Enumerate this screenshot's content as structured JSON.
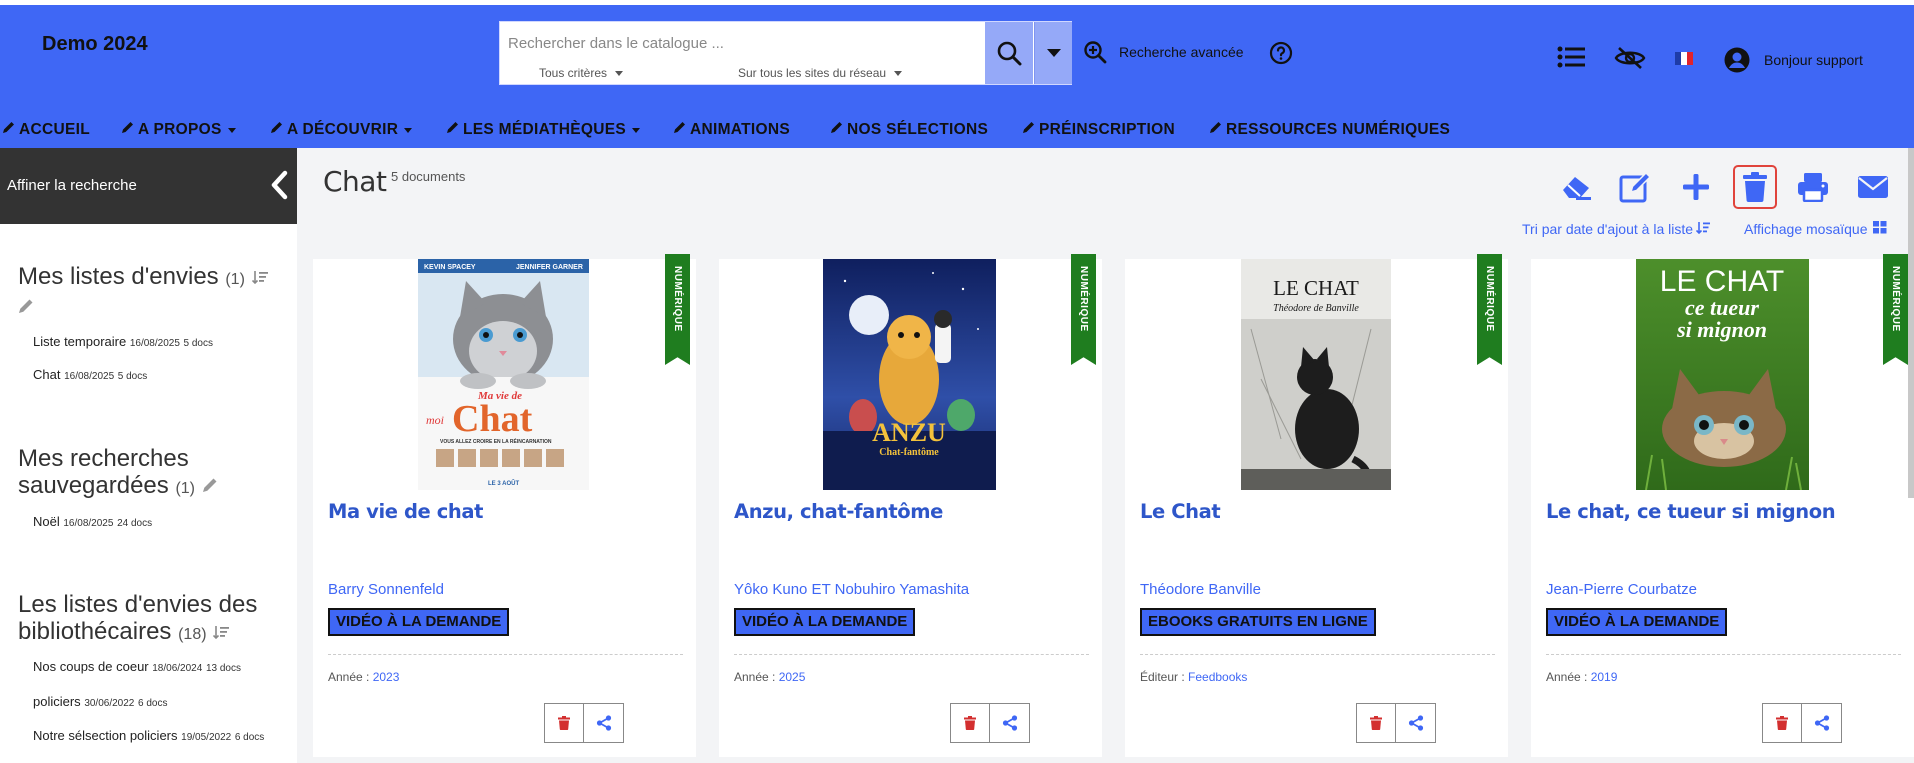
{
  "header": {
    "brand": "Demo 2024",
    "search_placeholder": "Rechercher dans le catalogue ...",
    "criteria_filter": "Tous critères",
    "sites_filter": "Sur tous les sites du réseau",
    "advanced_search": "Recherche avancée",
    "greeting": "Bonjour support"
  },
  "nav": {
    "items": [
      {
        "label": "ACCUEIL",
        "dropdown": false
      },
      {
        "label": "A PROPOS",
        "dropdown": true
      },
      {
        "label": "A DÉCOUVRIR",
        "dropdown": true
      },
      {
        "label": "LES MÉDIATHÈQUES",
        "dropdown": true
      },
      {
        "label": "ANIMATIONS",
        "dropdown": false
      },
      {
        "label": "NOS SÉLECTIONS",
        "dropdown": false
      },
      {
        "label": "PRÉINSCRIPTION",
        "dropdown": false
      },
      {
        "label": "RESSOURCES NUMÉRIQUES",
        "dropdown": false
      }
    ]
  },
  "sidebar": {
    "refine_label": "Affiner la recherche",
    "wishlists": {
      "title": "Mes listes d'envies",
      "count": "(1)",
      "items": [
        {
          "name": "Liste temporaire",
          "date": "16/08/2025",
          "docs": "5 docs"
        },
        {
          "name": "Chat",
          "date": "16/08/2025",
          "docs": "5 docs"
        }
      ]
    },
    "saved_searches": {
      "title_line1": "Mes recherches",
      "title_line2": "sauvegardées",
      "count": "(1)",
      "items": [
        {
          "name": "Noël",
          "date": "16/08/2025",
          "docs": "24 docs"
        }
      ]
    },
    "librarian_lists": {
      "title_line1": "Les listes d'envies des",
      "title_line2": "bibliothécaires",
      "count": "(18)",
      "items": [
        {
          "name": "Nos coups de coeur",
          "date": "18/06/2024",
          "docs": "13 docs"
        },
        {
          "name": "policiers",
          "date": "30/06/2022",
          "docs": "6 docs"
        },
        {
          "name": "Notre sélsection policiers",
          "date": "19/05/2022",
          "docs": "6 docs"
        }
      ]
    }
  },
  "content": {
    "title": "Chat",
    "count": "5 documents",
    "sort_label": "Tri par date d'ajout à la liste",
    "display_label": "Affichage mosaïque"
  },
  "cards": [
    {
      "ribbon": "NUMÉRIQUE",
      "title": "Ma vie de chat",
      "author1": "Barry Sonnenfeld",
      "author_sep": "",
      "author2": "",
      "badge": "VIDÉO À LA DEMANDE",
      "meta_label": "Année : ",
      "meta_value": "2023",
      "cover": {
        "top1": "KEVIN SPACEY",
        "top2": "JENNIFER GARNER",
        "small": "Ma vie de",
        "big": "Chat",
        "tag": "moi",
        "tagline": "VOUS ALLEZ CROIRE EN LA RÉINCARNATION",
        "date": "LE 3 AOÛT"
      }
    },
    {
      "ribbon": "NUMÉRIQUE",
      "title": "Anzu, chat-fantôme",
      "author1": "Yôko Kuno",
      "author_sep": " ET ",
      "author2": "Nobuhiro Yamashita",
      "badge": "VIDÉO À LA DEMANDE",
      "meta_label": "Année : ",
      "meta_value": "2025",
      "cover": {
        "big": "ANZU",
        "small": "Chat-fantôme"
      }
    },
    {
      "ribbon": "NUMÉRIQUE",
      "title": "Le Chat",
      "author1": "Théodore Banville",
      "author_sep": "",
      "author2": "",
      "badge": "EBOOKS GRATUITS EN LIGNE",
      "meta_label": "Éditeur : ",
      "meta_value": "Feedbooks",
      "cover": {
        "big": "LE CHAT",
        "small": "Théodore de Banville"
      }
    },
    {
      "ribbon": "NUMÉRIQUE",
      "title": "Le chat, ce tueur si mignon",
      "author1": "Jean-Pierre Courbatze",
      "author_sep": "",
      "author2": "",
      "badge": "VIDÉO À LA DEMANDE",
      "meta_label": "Année : ",
      "meta_value": "2019",
      "cover": {
        "big": "LE CHAT",
        "small1": "ce tueur",
        "small2": "si mignon"
      }
    }
  ],
  "colors": {
    "header": "#3f67f5",
    "accent": "#3f67f5",
    "title_link": "#2e56c9",
    "ribbon": "#1f7d1f",
    "danger": "#e0433b",
    "sidebar_head": "#333333"
  }
}
